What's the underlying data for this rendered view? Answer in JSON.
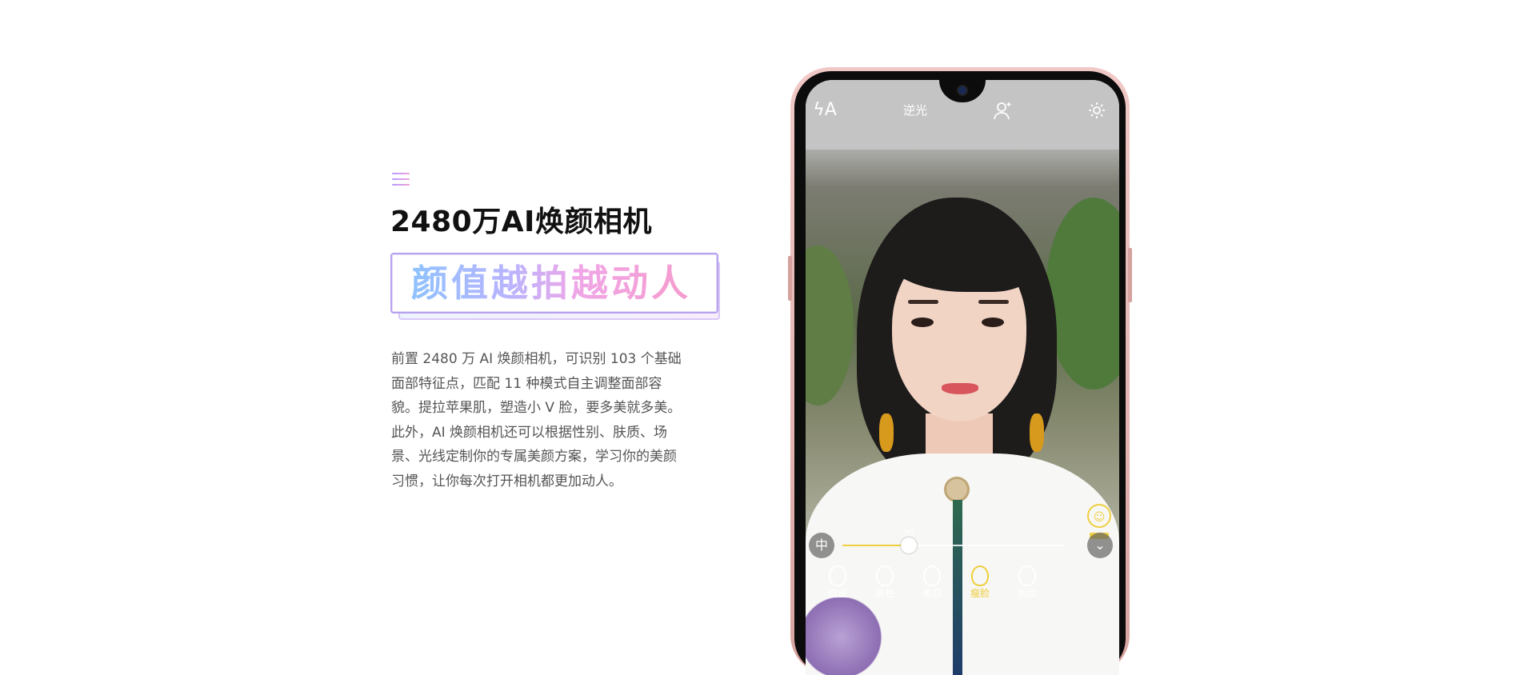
{
  "feature": {
    "headline": "2480万AI焕颜相机",
    "slogan": "颜值越拍越动人",
    "description": "前置 2480 万 AI 焕颜相机，可识别 103 个基础面部特征点，匹配 11 种模式自主调整面部容貌。提拉苹果肌，塑造小 V 脸，要多美就多美。此外，AI 焕颜相机还可以根据性别、肤质、场景、光线定制你的专属美颜方案，学习你的美颜习惯，让你每次打开相机都更加动人。"
  },
  "camera": {
    "topbar": {
      "flash_icon": "flash-auto-icon",
      "flash_label": "ϟA",
      "mode_label": "逆光",
      "portrait_icon": "portrait-add-icon",
      "settings_icon": "gear-icon"
    },
    "slider": {
      "value": 30,
      "value_label": "30",
      "left_button_label": "中",
      "right_button_icon": "chevron-down-icon"
    },
    "beauty_modes": [
      {
        "label": "磨皮",
        "icon": "face-smooth-icon",
        "active": false
      },
      {
        "label": "肤色",
        "icon": "face-tone-icon",
        "active": false
      },
      {
        "label": "美白",
        "icon": "face-whiten-icon",
        "active": false
      },
      {
        "label": "瘦脸",
        "icon": "face-slim-icon",
        "active": true
      },
      {
        "label": "削脸",
        "icon": "face-shave-icon",
        "active": false
      }
    ],
    "accent_color": "#f0cf40"
  },
  "colors": {
    "headline": "#111111",
    "description": "#555555",
    "phone_frame": "#e0b0ad"
  }
}
